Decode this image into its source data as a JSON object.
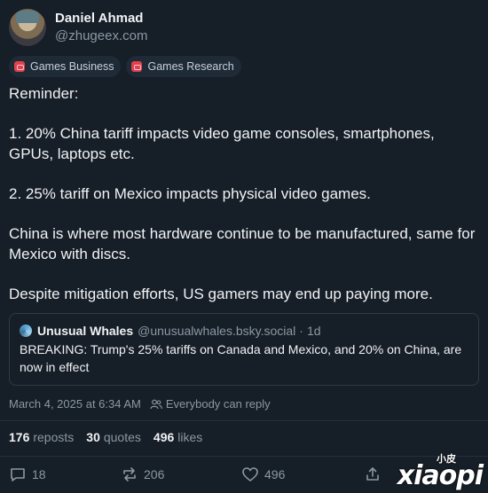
{
  "author": {
    "display_name": "Daniel Ahmad",
    "handle": "@zhugeex.com"
  },
  "tags": [
    {
      "label": "Games Business",
      "icon": "feed-icon"
    },
    {
      "label": "Games Research",
      "icon": "feed-icon"
    }
  ],
  "post": {
    "paragraphs": [
      "Reminder:",
      "1. 20% China tariff impacts video game consoles, smartphones, GPUs, laptops etc.",
      "2. 25% tariff on Mexico impacts physical video games.",
      "China is where most hardware continue to be manufactured, same for Mexico with discs.",
      "Despite mitigation efforts, US gamers may end up paying more."
    ]
  },
  "quoted_post": {
    "name": "Unusual Whales",
    "handle": "@unusualwhales.bsky.social",
    "separator": "·",
    "age": "1d",
    "text": "BREAKING: Trump's 25% tariffs on Canada and Mexico, and 20% on China, are now in effect"
  },
  "meta": {
    "timestamp": "March 4, 2025 at 6:34 AM",
    "reply_setting": "Everybody can reply"
  },
  "stats": {
    "reposts_count": "176",
    "reposts_label": "reposts",
    "quotes_count": "30",
    "quotes_label": "quotes",
    "likes_count": "496",
    "likes_label": "likes"
  },
  "actions": {
    "reply_count": "18",
    "repost_count": "206",
    "like_count": "496"
  },
  "watermark": {
    "text": "xiaopi",
    "small_text": "小皮"
  },
  "colors": {
    "background": "#161e27",
    "text": "#f1f3f5",
    "muted": "#8b98a5",
    "tag_icon": "#e0424a"
  }
}
